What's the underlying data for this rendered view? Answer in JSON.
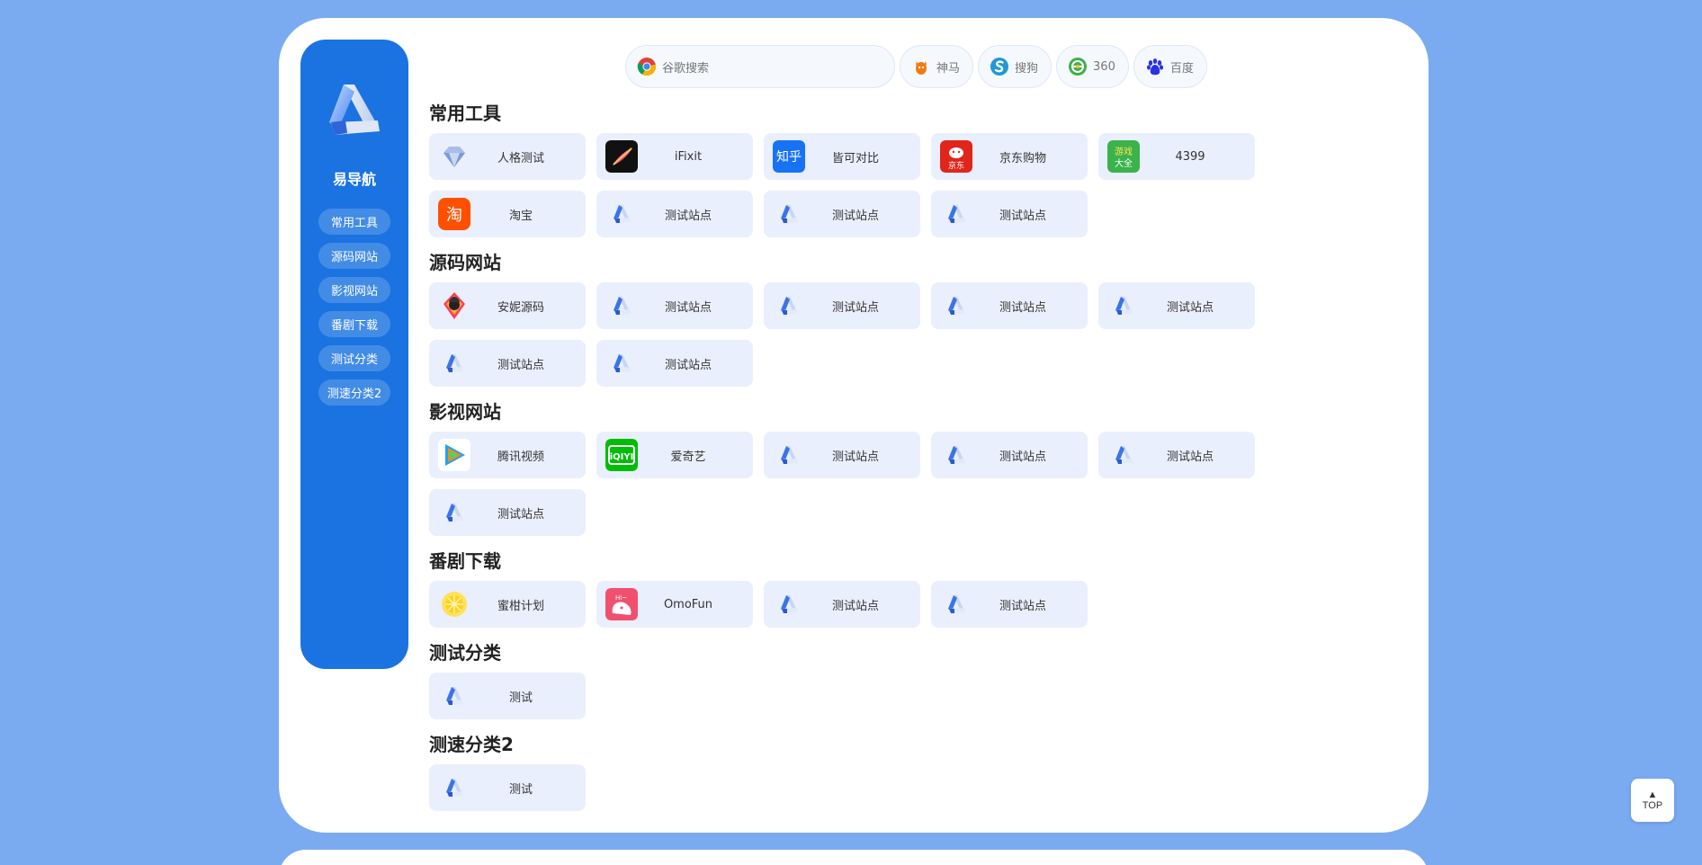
{
  "brand": {
    "name": "易导航"
  },
  "nav": [
    {
      "label": "常用工具"
    },
    {
      "label": "源码网站"
    },
    {
      "label": "影视网站"
    },
    {
      "label": "番剧下载"
    },
    {
      "label": "测试分类"
    },
    {
      "label": "测速分类2"
    }
  ],
  "search": {
    "placeholder": "谷歌搜索",
    "engines": [
      {
        "label": "神马",
        "icon": "shenma-icon"
      },
      {
        "label": "搜狗",
        "icon": "sogou-icon"
      },
      {
        "label": "360",
        "icon": "360-icon"
      },
      {
        "label": "百度",
        "icon": "baidu-icon"
      }
    ]
  },
  "categories": [
    {
      "title": "常用工具",
      "sites": [
        {
          "label": "人格测试",
          "icon": "diamond"
        },
        {
          "label": "iFixit",
          "icon": "ifixit"
        },
        {
          "label": "皆可对比",
          "icon": "zhihu",
          "text": "知乎"
        },
        {
          "label": "京东购物",
          "icon": "jd",
          "text": "京东"
        },
        {
          "label": "4399",
          "icon": "4399",
          "text": "游戏大全"
        },
        {
          "label": "淘宝",
          "icon": "taobao",
          "text": "淘"
        },
        {
          "label": "测试站点",
          "icon": "logo"
        },
        {
          "label": "测试站点",
          "icon": "logo"
        },
        {
          "label": "测试站点",
          "icon": "logo"
        }
      ]
    },
    {
      "title": "源码网站",
      "sites": [
        {
          "label": "安妮源码",
          "icon": "anni"
        },
        {
          "label": "测试站点",
          "icon": "logo"
        },
        {
          "label": "测试站点",
          "icon": "logo"
        },
        {
          "label": "测试站点",
          "icon": "logo"
        },
        {
          "label": "测试站点",
          "icon": "logo"
        },
        {
          "label": "测试站点",
          "icon": "logo"
        },
        {
          "label": "测试站点",
          "icon": "logo"
        }
      ]
    },
    {
      "title": "影视网站",
      "sites": [
        {
          "label": "腾讯视频",
          "icon": "tencent"
        },
        {
          "label": "爱奇艺",
          "icon": "iqiyi",
          "text": "iQIYI"
        },
        {
          "label": "测试站点",
          "icon": "logo"
        },
        {
          "label": "测试站点",
          "icon": "logo"
        },
        {
          "label": "测试站点",
          "icon": "logo"
        },
        {
          "label": "测试站点",
          "icon": "logo"
        }
      ]
    },
    {
      "title": "番剧下载",
      "sites": [
        {
          "label": "蜜柑计划",
          "icon": "mikan"
        },
        {
          "label": "OmoFun",
          "icon": "omofun",
          "text": "Hi~"
        },
        {
          "label": "测试站点",
          "icon": "logo"
        },
        {
          "label": "测试站点",
          "icon": "logo"
        }
      ]
    },
    {
      "title": "测试分类",
      "sites": [
        {
          "label": "测试",
          "icon": "logo"
        }
      ]
    },
    {
      "title": "测速分类2",
      "sites": [
        {
          "label": "测试",
          "icon": "logo"
        }
      ]
    }
  ],
  "top_button": {
    "arrow": "▲",
    "label": "TOP"
  }
}
